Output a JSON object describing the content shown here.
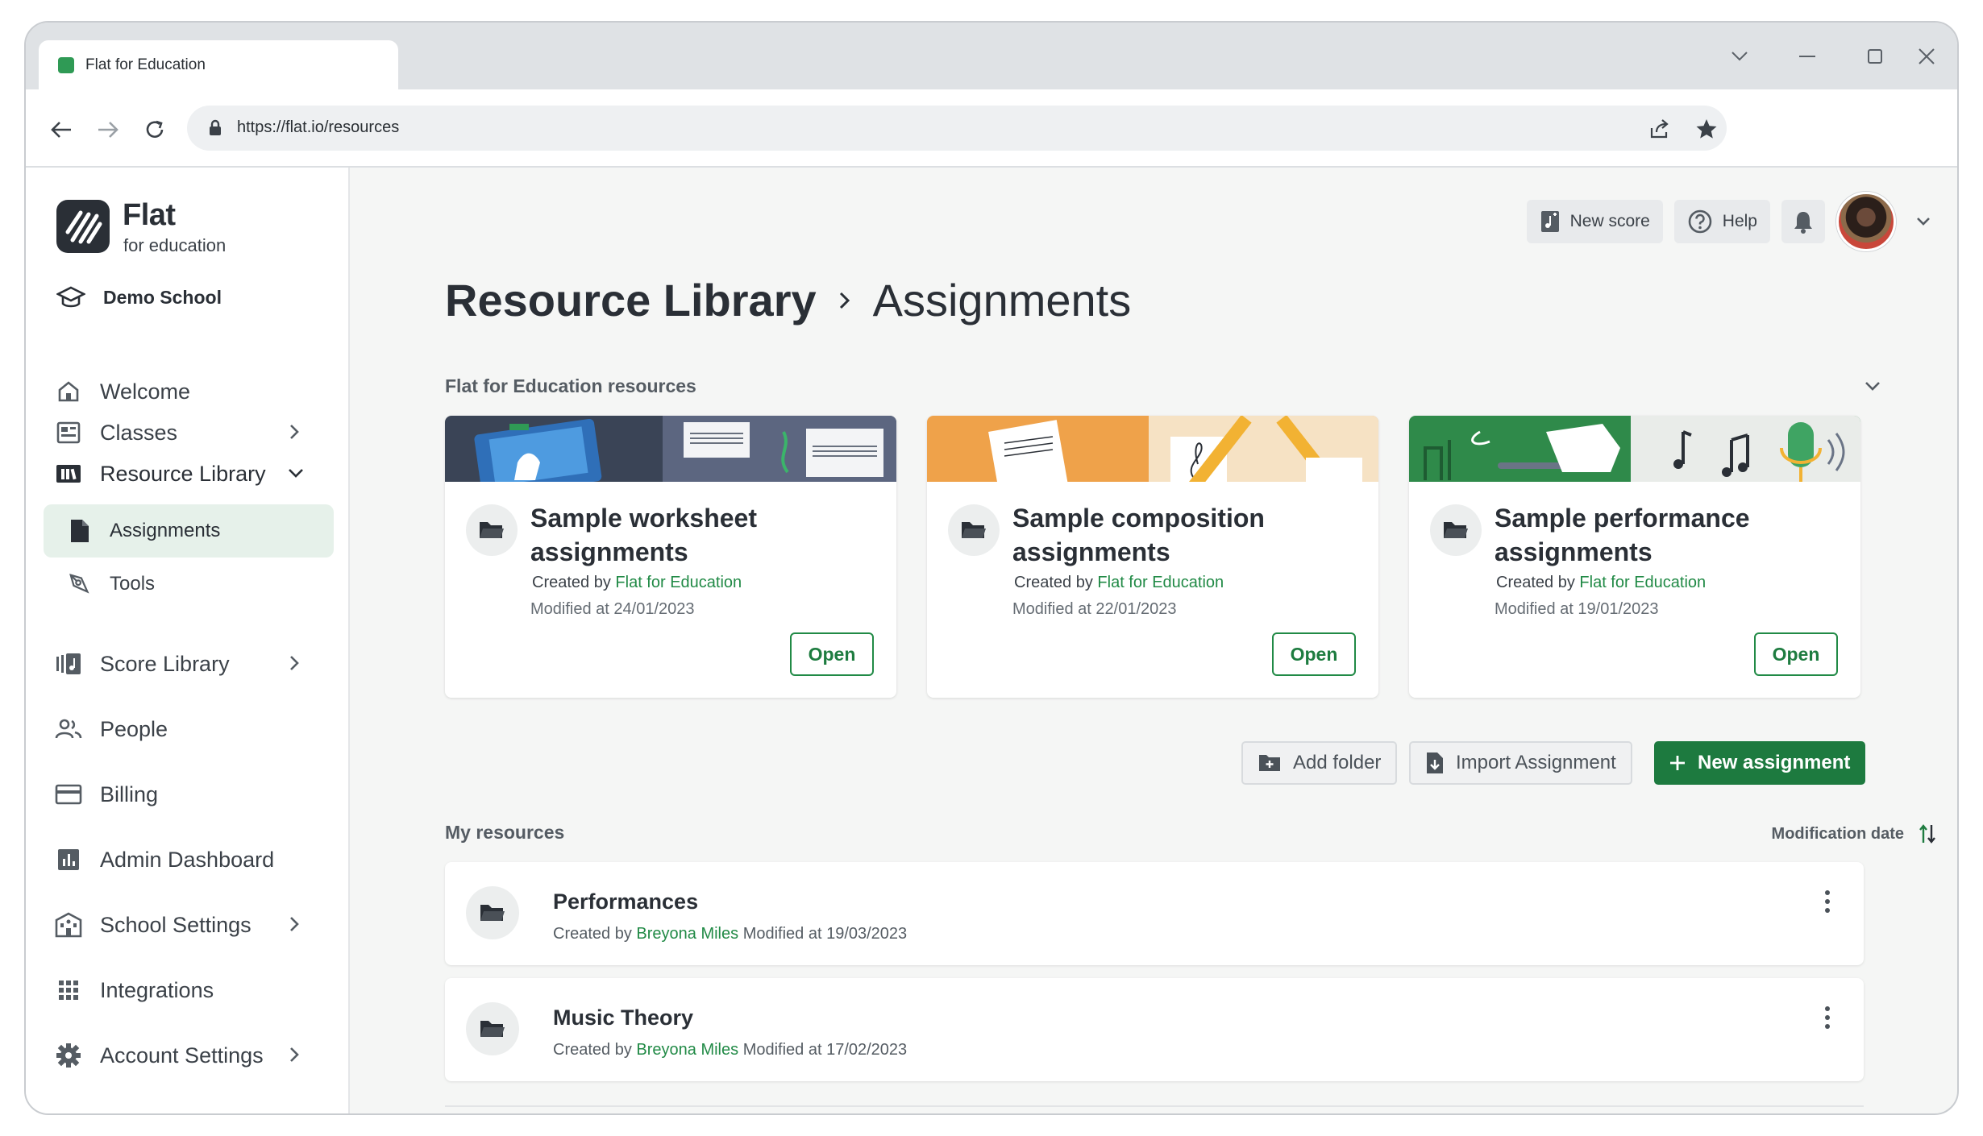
{
  "browser": {
    "tab_title": "Flat for Education",
    "url": "https://flat.io/resources"
  },
  "sidebar": {
    "logo_title": "Flat",
    "logo_subtitle": "for education",
    "school_name": "Demo School",
    "items": [
      {
        "label": "Welcome",
        "icon": "home-icon"
      },
      {
        "label": "Classes",
        "icon": "classes-icon"
      },
      {
        "label": "Resource Library",
        "icon": "library-icon"
      },
      {
        "label": "Score Library",
        "icon": "score-library-icon"
      },
      {
        "label": "People",
        "icon": "people-icon"
      },
      {
        "label": "Billing",
        "icon": "billing-icon"
      },
      {
        "label": "Admin Dashboard",
        "icon": "chart-icon"
      },
      {
        "label": "School Settings",
        "icon": "school-icon"
      },
      {
        "label": "Integrations",
        "icon": "grid-icon"
      },
      {
        "label": "Account Settings",
        "icon": "gear-icon"
      }
    ],
    "sub_items": [
      {
        "label": "Assignments",
        "icon": "document-icon",
        "active": true
      },
      {
        "label": "Tools",
        "icon": "tools-icon",
        "active": false
      }
    ]
  },
  "header": {
    "new_score_label": "New score",
    "help_label": "Help"
  },
  "breadcrumb": {
    "root": "Resource Library",
    "current": "Assignments"
  },
  "flat_resources": {
    "section_label": "Flat for Education resources",
    "cards": [
      {
        "title": "Sample worksheet assignments",
        "created_prefix": "Created by",
        "author": "Flat for Education",
        "modified": "Modified at 24/01/2023",
        "open_label": "Open"
      },
      {
        "title": "Sample composition assignments",
        "created_prefix": "Created by",
        "author": "Flat for Education",
        "modified": "Modified at 22/01/2023",
        "open_label": "Open"
      },
      {
        "title": "Sample performance assignments",
        "created_prefix": "Created by",
        "author": "Flat for Education",
        "modified": "Modified at 19/01/2023",
        "open_label": "Open"
      }
    ]
  },
  "actions": {
    "add_folder": "Add folder",
    "import_assignment": "Import Assignment",
    "new_assignment": "New assignment"
  },
  "my_resources": {
    "section_label": "My resources",
    "sort_label": "Modification date",
    "rows": [
      {
        "name": "Performances",
        "created_prefix": "Created by",
        "author": "Breyona Miles",
        "modified": "Modified at 19/03/2023"
      },
      {
        "name": "Music Theory",
        "created_prefix": "Created by",
        "author": "Breyona Miles",
        "modified": "Modified at 17/02/2023"
      }
    ]
  },
  "colors": {
    "brand_green": "#1d7a3f",
    "link_green": "#218a46",
    "active_nav_bg": "#e6f1ea"
  }
}
